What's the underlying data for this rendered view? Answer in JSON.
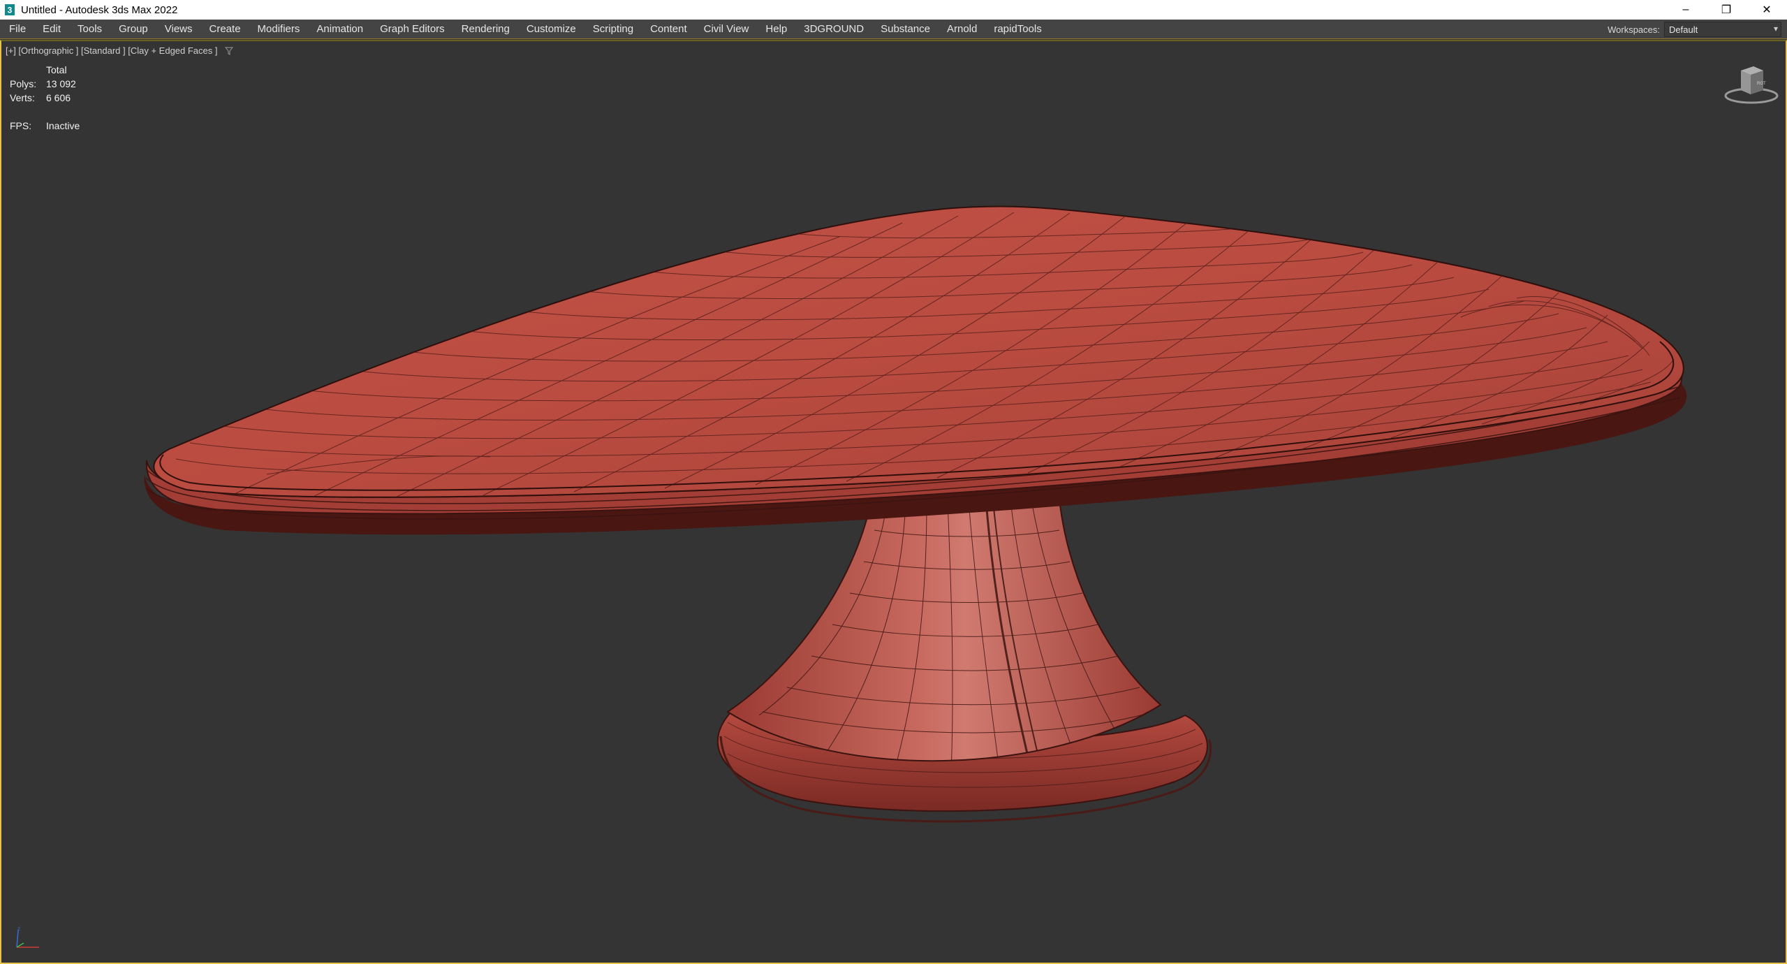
{
  "window": {
    "title": "Untitled - Autodesk 3ds Max 2022",
    "minimize_glyph": "–",
    "maximize_glyph": "❐",
    "close_glyph": "✕"
  },
  "menubar": {
    "items": [
      "File",
      "Edit",
      "Tools",
      "Group",
      "Views",
      "Create",
      "Modifiers",
      "Animation",
      "Graph Editors",
      "Rendering",
      "Customize",
      "Scripting",
      "Content",
      "Civil View",
      "Help",
      "3DGROUND",
      "Substance",
      "Arnold",
      "rapidTools"
    ],
    "workspaces_label": "Workspaces:",
    "workspace_value": "Default"
  },
  "viewport": {
    "label": "[+] [Orthographic ] [Standard ] [Clay + Edged Faces ]",
    "stats": {
      "header": "Total",
      "polys_label": "Polys:",
      "polys_value": "13 092",
      "verts_label": "Verts:",
      "verts_value": "6 606",
      "fps_label": "FPS:",
      "fps_value": "Inactive"
    },
    "model_color": "#b8463b",
    "background": "#343434",
    "accent_border": "#e8c34b"
  }
}
